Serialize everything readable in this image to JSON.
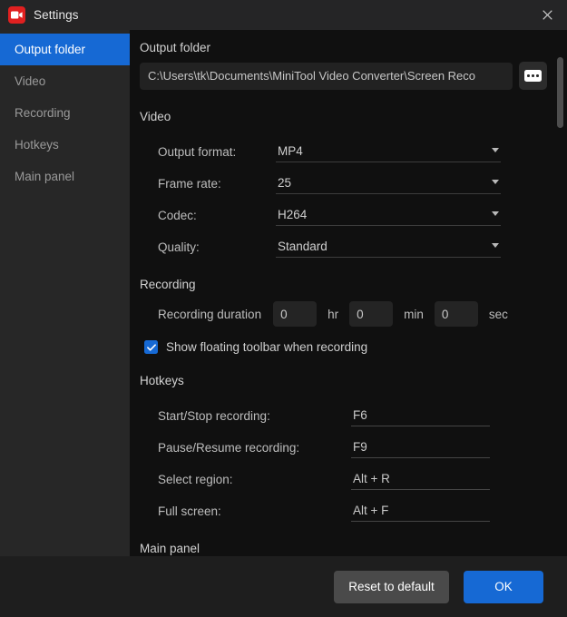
{
  "titlebar": {
    "title": "Settings",
    "app_icon": "video-camera-icon",
    "close_icon": "close-icon"
  },
  "sidebar": {
    "items": [
      {
        "label": "Output folder",
        "active": true
      },
      {
        "label": "Video",
        "active": false
      },
      {
        "label": "Recording",
        "active": false
      },
      {
        "label": "Hotkeys",
        "active": false
      },
      {
        "label": "Main panel",
        "active": false
      }
    ]
  },
  "output_folder": {
    "heading": "Output folder",
    "path": "C:\\Users\\tk\\Documents\\MiniTool Video Converter\\Screen Reco",
    "browse_icon": "ellipsis-icon"
  },
  "video": {
    "heading": "Video",
    "fields": [
      {
        "label": "Output format:",
        "value": "MP4"
      },
      {
        "label": "Frame rate:",
        "value": "25"
      },
      {
        "label": "Codec:",
        "value": "H264"
      },
      {
        "label": "Quality:",
        "value": "Standard"
      }
    ]
  },
  "recording": {
    "heading": "Recording",
    "duration_label": "Recording duration",
    "hours": "0",
    "hours_unit": "hr",
    "minutes": "0",
    "minutes_unit": "min",
    "seconds": "0",
    "seconds_unit": "sec",
    "floating_toolbar_label": "Show floating toolbar when recording",
    "floating_toolbar_checked": true
  },
  "hotkeys": {
    "heading": "Hotkeys",
    "items": [
      {
        "label": "Start/Stop recording:",
        "value": "F6"
      },
      {
        "label": "Pause/Resume recording:",
        "value": "F9"
      },
      {
        "label": "Select region:",
        "value": "Alt + R"
      },
      {
        "label": "Full screen:",
        "value": "Alt + F"
      }
    ]
  },
  "main_panel": {
    "heading": "Main panel"
  },
  "footer": {
    "reset_label": "Reset to default",
    "ok_label": "OK"
  },
  "colors": {
    "accent": "#1669d4",
    "app_icon": "#e02020",
    "window_bg": "#1e1e1e",
    "sidebar_bg": "#272727",
    "content_bg": "#101010"
  }
}
